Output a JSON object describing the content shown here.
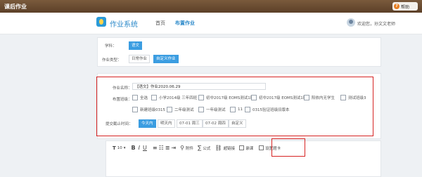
{
  "titlebar": {
    "title": "课后作业",
    "help_label": "帮助"
  },
  "header": {
    "app_name": "作业系统",
    "nav": [
      "首页",
      "布置作业"
    ],
    "welcome": "欢迎您，孙文文老师"
  },
  "subject": {
    "label": "学科：",
    "value": "语文"
  },
  "homework_type": {
    "label": "作业类型：",
    "options": [
      "日常作业",
      "自定义作业"
    ],
    "selected": 1
  },
  "form": {
    "name_label": "作业名称：",
    "name_value": "【语文】作业2020.06.29",
    "class_label": "布置班级：",
    "classes": [
      "全选",
      "小学2014级 三年四班",
      "初中2017级 EOMS测试1班",
      "初中2017级 EOMS测试1班",
      "阳依内无学生",
      "测试班级3",
      "新建班级0315",
      "二年级测试",
      "一年级测试",
      "11",
      "0315验证班级旧版本"
    ],
    "deadline_label": "提交截止时间：",
    "deadline_options": [
      "今天内",
      "明天内",
      "07-01 周三",
      "07-02 周四",
      "自定义"
    ],
    "deadline_selected": 0
  },
  "editor": {
    "font_size": "10",
    "tools": [
      "附件",
      "公式",
      "超链接",
      "录课",
      "设置题卡"
    ]
  },
  "colors": {
    "accent": "#3b9de1",
    "highlight": "#d62323",
    "titlebar": "#6b4c31"
  }
}
